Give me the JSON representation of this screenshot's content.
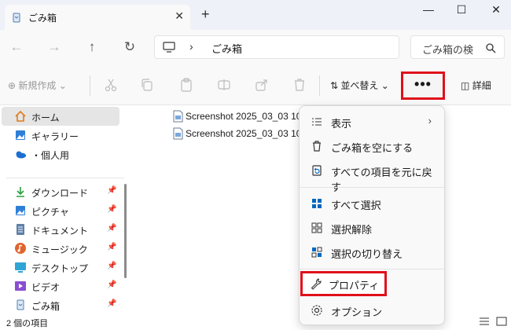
{
  "window": {
    "tab_title": "ごみ箱",
    "tab_close": "✕",
    "new_tab": "+",
    "minimize": "—",
    "maximize": "☐",
    "close": "✕"
  },
  "address": {
    "separator": "›",
    "path": "ごみ箱",
    "search_placeholder": "ごみ箱の検"
  },
  "toolbar": {
    "new_label": "新規作成",
    "sort_label": "並べ替え",
    "more_label": "•••",
    "details_label": "詳細"
  },
  "sidebar": {
    "items": [
      {
        "label": "ホーム",
        "icon": "home-icon"
      },
      {
        "label": "ギャラリー",
        "icon": "gallery-icon"
      },
      {
        "label": "・個人用",
        "icon": "onedrive-icon"
      },
      {
        "label": "ダウンロード",
        "icon": "download-icon",
        "pinned": true
      },
      {
        "label": "ピクチャ",
        "icon": "pictures-icon",
        "pinned": true
      },
      {
        "label": "ドキュメント",
        "icon": "documents-icon",
        "pinned": true
      },
      {
        "label": "ミュージック",
        "icon": "music-icon",
        "pinned": true
      },
      {
        "label": "デスクトップ",
        "icon": "desktop-icon",
        "pinned": true
      },
      {
        "label": "ビデオ",
        "icon": "videos-icon",
        "pinned": true
      },
      {
        "label": "ごみ箱",
        "icon": "recycle-bin-icon",
        "pinned": true
      }
    ],
    "pin_glyph": "📌"
  },
  "files": [
    {
      "name": "Screenshot 2025_03_03 10_0"
    },
    {
      "name": "Screenshot 2025_03_03 10_1"
    }
  ],
  "menu": {
    "items": [
      {
        "label": "表示",
        "icon": "view-icon",
        "has_submenu": true
      },
      {
        "label": "ごみ箱を空にする",
        "icon": "empty-recycle-bin-icon"
      },
      {
        "label": "すべての項目を元に戻す",
        "icon": "restore-all-icon"
      },
      {
        "label": "すべて選択",
        "icon": "select-all-icon"
      },
      {
        "label": "選択解除",
        "icon": "select-none-icon"
      },
      {
        "label": "選択の切り替え",
        "icon": "invert-selection-icon"
      },
      {
        "label": "プロパティ",
        "icon": "properties-icon"
      },
      {
        "label": "オプション",
        "icon": "options-icon"
      }
    ],
    "submenu_arrow": "›"
  },
  "status": {
    "item_count": "2 個の項目"
  },
  "colors": {
    "highlight_red": "#e0101a",
    "accent_blue": "#0067c0"
  }
}
